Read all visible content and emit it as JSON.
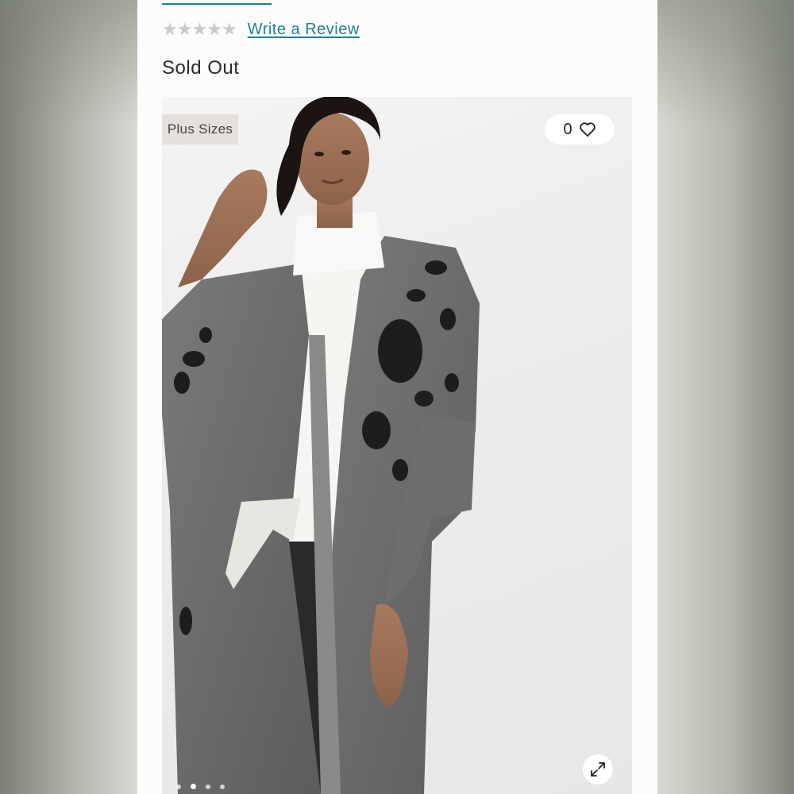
{
  "product": {
    "top_link_text": "",
    "rating": {
      "stars": 5,
      "filled": 0
    },
    "write_review_label": "Write a Review",
    "availability": "Sold Out"
  },
  "gallery": {
    "badge_label": "Plus Sizes",
    "favorite_count": "0",
    "image_count": 4,
    "active_index": 1
  },
  "icons": {
    "favorite": "heart-icon",
    "expand": "expand-icon",
    "star": "star-icon"
  },
  "colors": {
    "link": "#1f7f99",
    "star_empty": "#c9c9c9",
    "badge_bg": "#e4e0dc"
  }
}
